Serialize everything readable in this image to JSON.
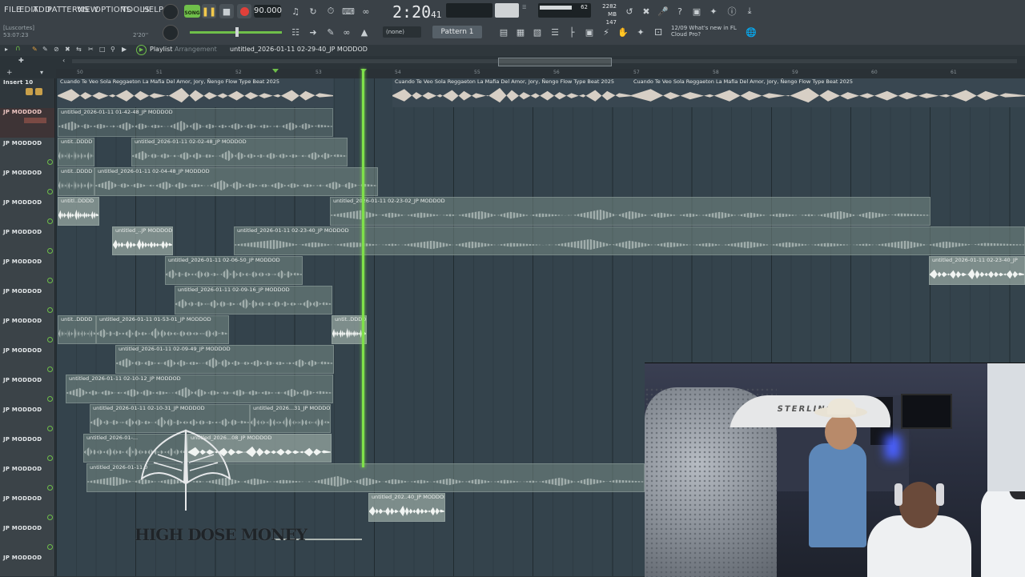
{
  "menu": [
    "FILE",
    "EDIT",
    "ADD",
    "PATTERNS",
    "VIEW",
    "OPTIONS",
    "TOOLS",
    "HELP"
  ],
  "transport": {
    "mode": "SONG",
    "tempo": "90.000",
    "time_main": "2:20",
    "time_sub": "41",
    "time_tag": "M:S:CS"
  },
  "meters": {
    "cpu": "62",
    "memory": "2282 MB",
    "polyphony": "147"
  },
  "hint": {
    "project": "[Luscortes]",
    "time": "53:07:23",
    "pos": "2'20''"
  },
  "pattern": {
    "selector": "(none)",
    "name": "Pattern 1"
  },
  "notice": {
    "date": "12/09",
    "line1": "What's new in FL",
    "line2": "Cloud Pro?"
  },
  "playlist": {
    "title": "Playlist",
    "section": "Arrangement",
    "file": "untitled_2026-01-11 02-29-40_JP MODDOD"
  },
  "ruler_ticks": [
    "50",
    "51",
    "52",
    "53",
    "54",
    "55",
    "56",
    "57",
    "58",
    "59",
    "60",
    "61"
  ],
  "tracks": [
    {
      "name": "Insert 10"
    },
    {
      "name": "JP MODDOD"
    },
    {
      "name": "JP MODDOD"
    },
    {
      "name": "JP MODDOD"
    },
    {
      "name": "JP MODDOD"
    },
    {
      "name": "JP MODDOD"
    },
    {
      "name": "JP MODDOD"
    },
    {
      "name": "JP MODDOD"
    },
    {
      "name": "JP MODDOD"
    },
    {
      "name": "JP MODDOD"
    },
    {
      "name": "JP MODDOD"
    },
    {
      "name": "JP MODDOD"
    },
    {
      "name": "JP MODDOD"
    },
    {
      "name": "JP MODDOD"
    },
    {
      "name": "JP MODDOD"
    },
    {
      "name": "JP MODDOD"
    },
    {
      "name": "JP MODDOD"
    }
  ],
  "clips": {
    "master1": "Cuando Te Veo Sola  Reggaeton  La Mafia Del Amor, Jory, Ñengo Flow Type Beat 2025",
    "master2": "Cuando Te Veo Sola  Reggaeton  La Mafia Del Amor, Jory, Ñengo Flow Type Beat 2025",
    "master3": "Cuando Te Veo Sola  Reggaeton  La Mafia Del Amor, Jory, Ñengo Flow Type Beat 2025",
    "c1": "untitled_2026-01-11 01-42-48_JP MODDOD",
    "c2a": "untit..DDDD",
    "c2b": "untitled_2026-01-11 02-02-48_JP MODDOD",
    "c3a": "untit..DDDD",
    "c3b": "untitled_2026-01-11 02-04-48_JP MODDOD",
    "c4a": "untitl..DDDD",
    "c4b": "untitled_2026-01-11 02-23-02_JP MODDOD",
    "c5a": "untitled_..JP MODDOD",
    "c5b": "untitled_2026-01-11 02-23-40_JP MODDOD",
    "c6a": "untitled_2026-01-11 02-06-50_JP MODDOD",
    "c6b": "untitled_2026-01-11 02-23-40_JP",
    "c7": "untitled_2026-01-11 02-09-16_JP MODDOD",
    "c8a": "untit..DDDD",
    "c8b": "untitled_2026-01-11 01-53-01_JP MODDOD",
    "c8c": "untit..DDDD",
    "c9": "untitled_2026-01-11 02-09-49_JP MODDOD",
    "c10": "untitled_2026-01-11 02-10-12_JP MODDOD",
    "c11a": "untitled_2026-01-11 02-10-31_JP MODDOD",
    "c11b": "untitled_2026...31_JP MODDOD",
    "c12a": "untitled_2026-01-...",
    "c12b": "untitled_2026...08_JP MODDOD",
    "c13": "untitled_2026-01-11 0",
    "c14": "untitled_202..40_JP MODDOD"
  },
  "overlay": {
    "watermark": "HIGH DOSE MONEY",
    "booth_brand": "STERLING"
  }
}
